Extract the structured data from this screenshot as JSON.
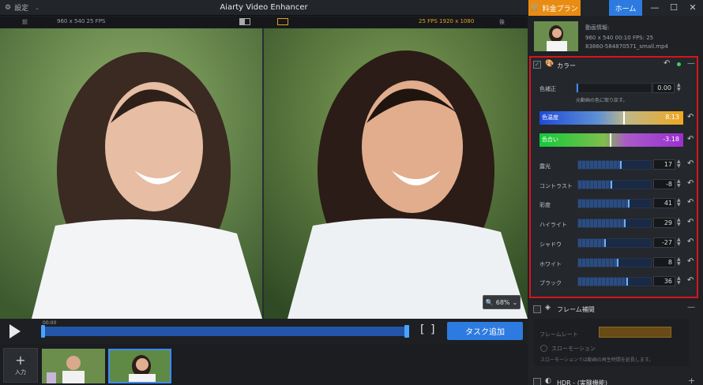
{
  "titlebar": {
    "settings_label": "設定",
    "app_title": "Aiarty Video Enhancer",
    "pricing_label": "料金プラン",
    "home_label": "ホーム"
  },
  "preview": {
    "before_label": "前",
    "after_label": "後",
    "before_info": "960 x 540  25 FPS",
    "after_info": "25 FPS  1920 x 1080",
    "zoom": "68%"
  },
  "timeline": {
    "timecode": "00:00",
    "bracket_left": "[",
    "bracket_right": "]",
    "task_button": "タスク追加",
    "progress": 0.99
  },
  "media": {
    "add_label": "入力"
  },
  "info": {
    "title": "動画情報:",
    "meta": "960 x 540  00:10  FPS: 25",
    "file": "83860-584870571_small.mp4"
  },
  "color": {
    "title": "カラー",
    "correction": {
      "label": "色補正",
      "value": "0.00",
      "hint": "元動画の色に取り戻す。"
    },
    "temperature": {
      "label": "色温度",
      "value": "8.13",
      "position": 0.58
    },
    "tint": {
      "label": "色合い",
      "value": "-3.18",
      "position": 0.49
    },
    "adjust": [
      {
        "label": "露光",
        "value": "17",
        "fill": 0.59
      },
      {
        "label": "コントラスト",
        "value": "-8",
        "fill": 0.46
      },
      {
        "label": "彩度",
        "value": "41",
        "fill": 0.7
      },
      {
        "label": "ハイライト",
        "value": "29",
        "fill": 0.64
      },
      {
        "label": "シャドウ",
        "value": "-27",
        "fill": 0.37
      },
      {
        "label": "ホワイト",
        "value": "8",
        "fill": 0.54
      },
      {
        "label": "ブラック",
        "value": "36",
        "fill": 0.67
      }
    ]
  },
  "frame": {
    "title": "フレーム補間",
    "rate_label": "フレームレート",
    "slowmo_label": "スローモーション",
    "slowmo_hint": "スローモーションでは動画の再生時間を延長します。",
    "hdr_label": "HDR - (実験機能)"
  }
}
